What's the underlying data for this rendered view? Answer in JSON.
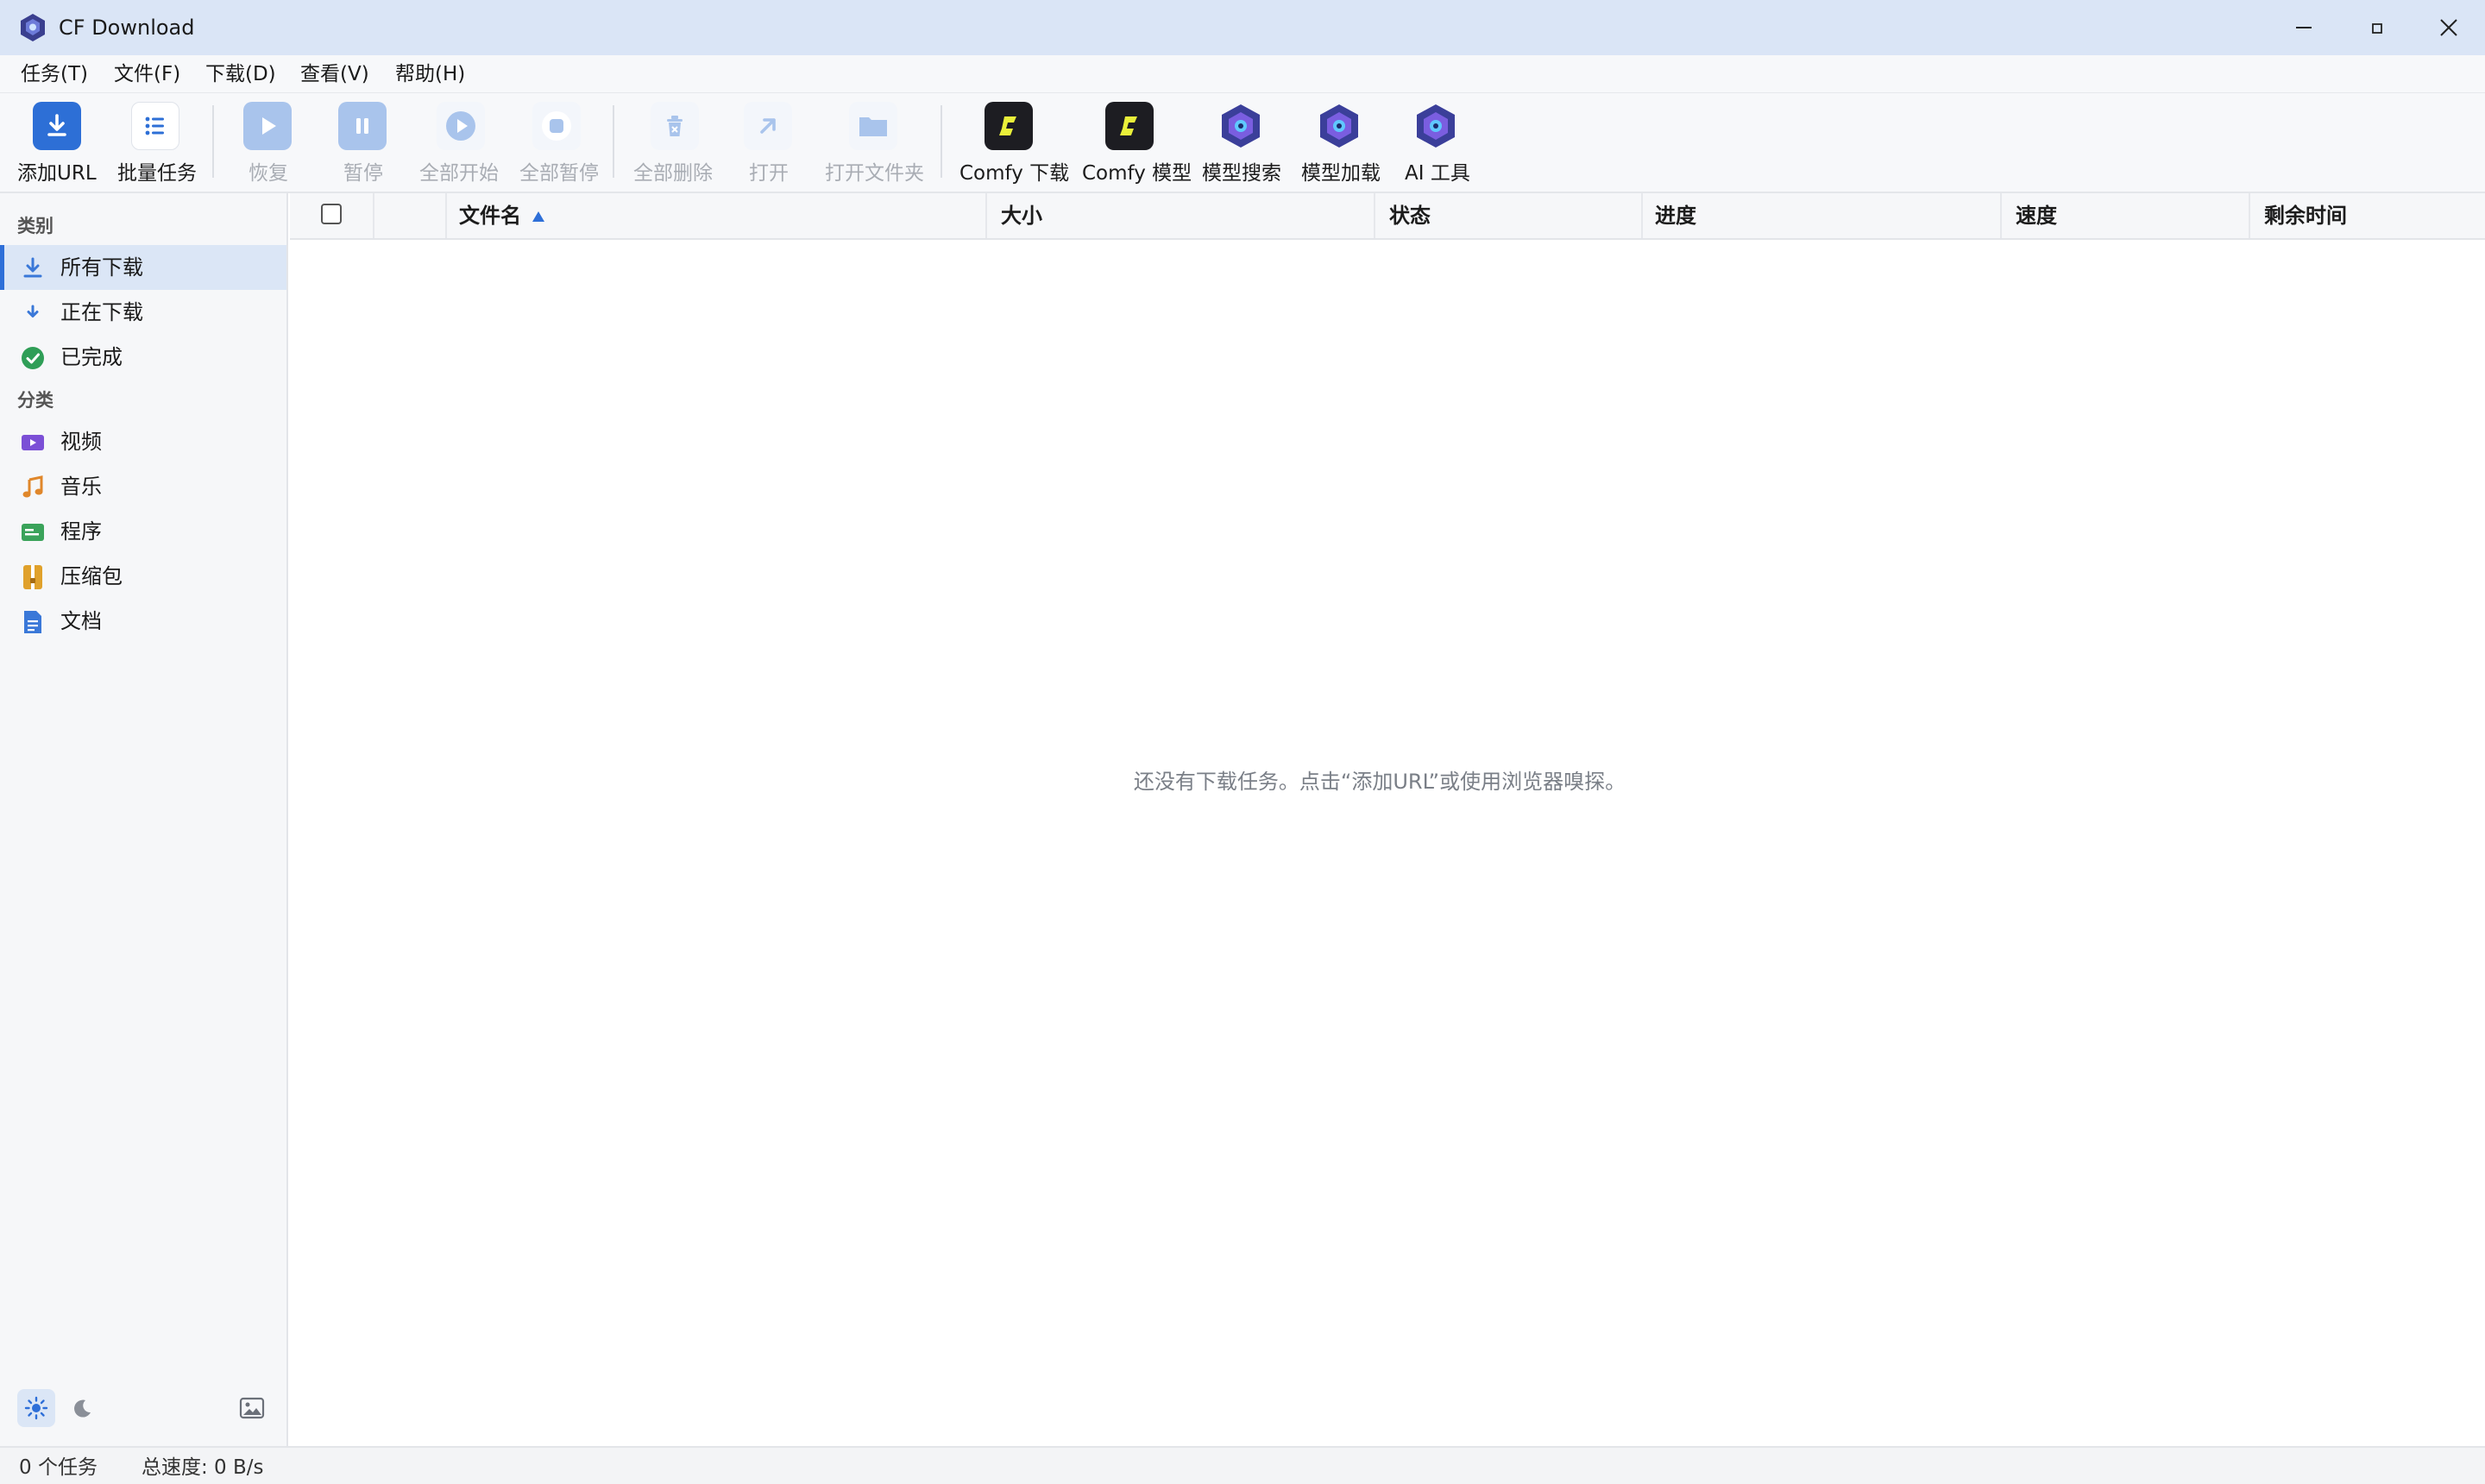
{
  "window": {
    "title": "CF Download"
  },
  "menu": [
    {
      "label": "任务(T)"
    },
    {
      "label": "文件(F)"
    },
    {
      "label": "下载(D)"
    },
    {
      "label": "查看(V)"
    },
    {
      "label": "帮助(H)"
    }
  ],
  "toolbar": {
    "add_url": {
      "label": "添加URL",
      "icon": "download-icon",
      "enabled": true
    },
    "batch": {
      "label": "批量任务",
      "icon": "list-icon",
      "enabled": true
    },
    "resume": {
      "label": "恢复",
      "icon": "play-icon",
      "enabled": false
    },
    "pause": {
      "label": "暂停",
      "icon": "pause-icon",
      "enabled": false
    },
    "start_all": {
      "label": "全部开始",
      "icon": "play-circle-icon",
      "enabled": false
    },
    "pause_all": {
      "label": "全部暂停",
      "icon": "stop-icon",
      "enabled": false
    },
    "delete_all": {
      "label": "全部删除",
      "icon": "trash-icon",
      "enabled": false
    },
    "open": {
      "label": "打开",
      "icon": "open-arrow-icon",
      "enabled": false
    },
    "open_folder": {
      "label": "打开文件夹",
      "icon": "folder-icon",
      "enabled": false
    },
    "comfy_download": {
      "label": "Comfy 下载",
      "icon": "comfy-logo-icon",
      "enabled": true
    },
    "comfy_model": {
      "label": "Comfy 模型",
      "icon": "comfy-logo-icon",
      "enabled": true
    },
    "model_search": {
      "label": "模型搜索",
      "icon": "cube-logo-icon",
      "enabled": true
    },
    "model_load": {
      "label": "模型加载",
      "icon": "cube-logo-icon",
      "enabled": true
    },
    "ai_tools": {
      "label": "AI 工具",
      "icon": "cube-logo-icon",
      "enabled": true
    }
  },
  "sidebar": {
    "category_heading": "类别",
    "categories": [
      {
        "label": "所有下载",
        "icon": "download-arrow-icon",
        "active": true
      },
      {
        "label": "正在下载",
        "icon": "small-download-icon",
        "active": false
      },
      {
        "label": "已完成",
        "icon": "check-circle-icon",
        "active": false
      }
    ],
    "type_heading": "分类",
    "types": [
      {
        "label": "视频",
        "icon": "video-icon",
        "color": "#7b4fd6"
      },
      {
        "label": "音乐",
        "icon": "music-icon",
        "color": "#e0872b"
      },
      {
        "label": "程序",
        "icon": "program-icon",
        "color": "#3aa35a"
      },
      {
        "label": "压缩包",
        "icon": "archive-icon",
        "color": "#e0a12b"
      },
      {
        "label": "文档",
        "icon": "document-icon",
        "color": "#3a78d8"
      }
    ]
  },
  "table": {
    "columns": [
      {
        "label": "文件名",
        "sorted": "ascending"
      },
      {
        "label": "大小"
      },
      {
        "label": "状态"
      },
      {
        "label": "进度"
      },
      {
        "label": "速度"
      },
      {
        "label": "剩余时间"
      }
    ],
    "rows": [],
    "empty_message": "还没有下载任务。点击“添加URL”或使用浏览器嗅探。"
  },
  "statusbar": {
    "task_count": "0 个任务",
    "total_speed": "总速度: 0 B/s"
  },
  "colors": {
    "accent": "#2e6fd8",
    "titlebar": "#dae5f6"
  }
}
